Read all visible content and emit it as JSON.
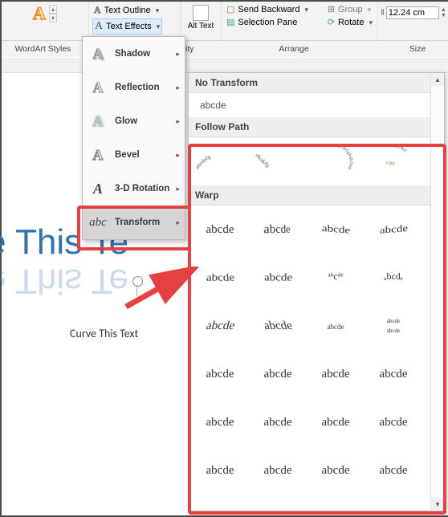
{
  "ribbon": {
    "text_outline": "Text Outline",
    "text_effects": "Text Effects",
    "alt_text": "Alt Text",
    "bility_suffix": "bility",
    "send_backward": "Send Backward",
    "selection_pane": "Selection Pane",
    "group": "Group",
    "rotate": "Rotate",
    "size_value": "12.24 cm"
  },
  "groups": {
    "wordart": "WordArt Styles",
    "arrange": "Arrange",
    "size": "Size"
  },
  "dropdown": {
    "items": [
      "Shadow",
      "Reflection",
      "Glow",
      "Bevel",
      "3-D Rotation",
      "Transform"
    ]
  },
  "gallery": {
    "no_transform": "No Transform",
    "follow_path": "Follow Path",
    "warp": "Warp",
    "sample_plain": "abcde",
    "sample": "abcde",
    "alpha": "abcdefg",
    "alpha2": "hijklm",
    "alpha3": "Ghij",
    "alpha4": "nopqrs"
  },
  "document": {
    "main_text": "urve This Te",
    "placeholder": "Curve This Text"
  }
}
